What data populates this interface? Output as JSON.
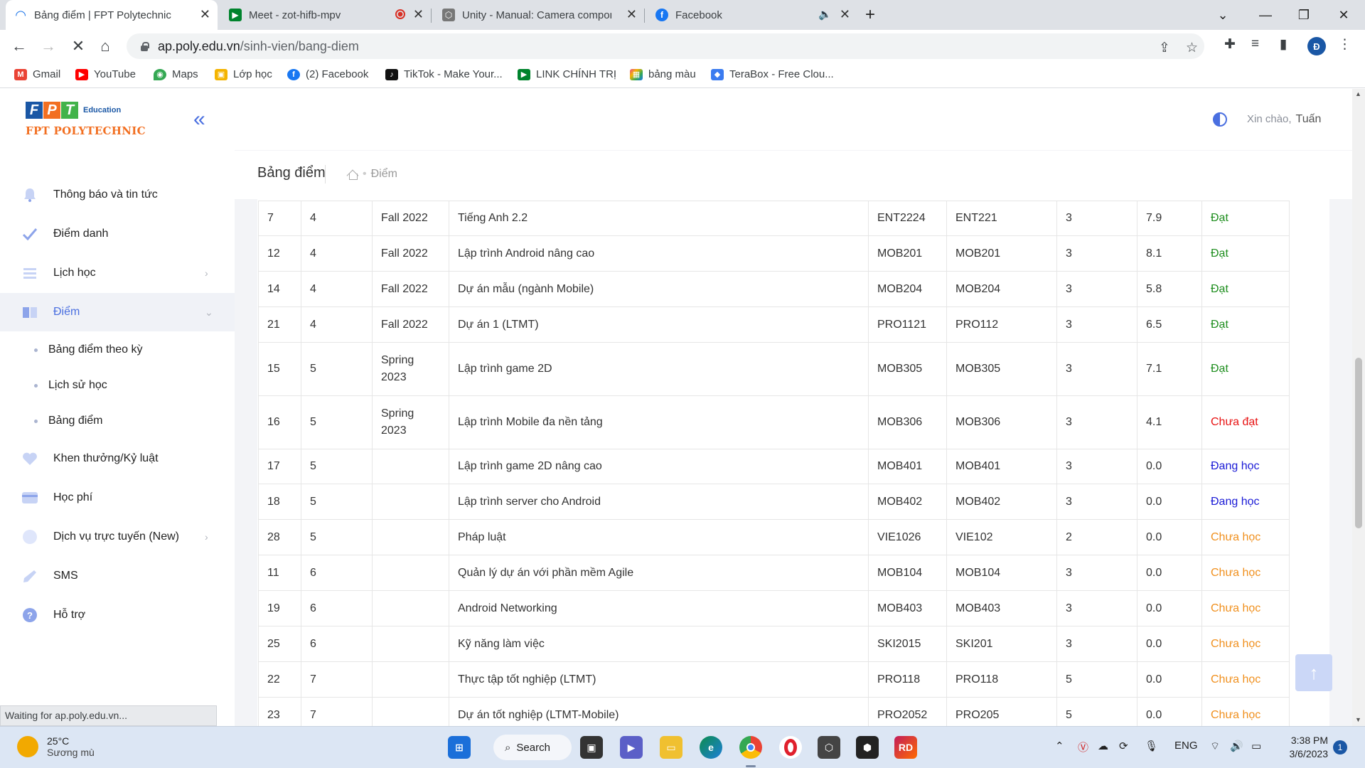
{
  "browser": {
    "tabs": [
      {
        "title": "Bảng điểm | FPT Polytechnic",
        "active": true,
        "fav_color": "#f26f21",
        "fav_glyph": "◠"
      },
      {
        "title": "Meet - zot-hifb-mpv",
        "active": false,
        "fav_color": "#00832d",
        "fav_glyph": "▶"
      },
      {
        "title": "Unity - Manual: Camera compon",
        "active": false,
        "fav_color": "#888888",
        "fav_glyph": "⬡"
      },
      {
        "title": "Facebook",
        "active": false,
        "fav_color": "#1877f2",
        "fav_glyph": "f"
      }
    ],
    "new_tab": "+",
    "url_host": "ap.poly.edu.vn",
    "url_path": "/sinh-vien/bang-diem",
    "profile_initial": "Đ",
    "bookmarks": [
      {
        "label": "Gmail",
        "color": "#ea4335",
        "glyph": "M"
      },
      {
        "label": "YouTube",
        "color": "#ff0000",
        "glyph": "▶"
      },
      {
        "label": "Maps",
        "color": "#34a853",
        "glyph": "◉"
      },
      {
        "label": "Lớp học",
        "color": "#f4b400",
        "glyph": "▣"
      },
      {
        "label": "(2) Facebook",
        "color": "#1877f2",
        "glyph": "f"
      },
      {
        "label": "TikTok - Make Your...",
        "color": "#111111",
        "glyph": "♪"
      },
      {
        "label": "LINK CHÍNH TRỊ",
        "color": "#00832d",
        "glyph": "▶"
      },
      {
        "label": "bảng màu",
        "color": "#e94b8a",
        "glyph": "▦"
      },
      {
        "label": "TeraBox - Free Clou...",
        "color": "#3a7bf0",
        "glyph": "◆"
      }
    ],
    "status_text": "Waiting for ap.poly.edu.vn..."
  },
  "sidebar": {
    "logo_letters": [
      "F",
      "P",
      "T"
    ],
    "logo_colors": [
      "#1a57a5",
      "#f26f21",
      "#42b34a"
    ],
    "logo_edu": "Education",
    "logo_name": "FPT POLYTECHNIC",
    "items": [
      {
        "label": "Thông báo và tin tức",
        "icon": "bell-icon",
        "has_chevron": false
      },
      {
        "label": "Điểm danh",
        "icon": "check-icon",
        "has_chevron": false
      },
      {
        "label": "Lịch học",
        "icon": "list-icon",
        "has_chevron": true
      },
      {
        "label": "Điểm",
        "icon": "book-icon",
        "has_chevron": true,
        "active": true
      },
      {
        "label": "Khen thưởng/Kỷ luật",
        "icon": "heart-icon",
        "has_chevron": false
      },
      {
        "label": "Học phí",
        "icon": "card-icon",
        "has_chevron": false
      },
      {
        "label": "Dịch vụ trực tuyến (New)",
        "icon": "globe-icon",
        "has_chevron": true
      },
      {
        "label": "SMS",
        "icon": "phone-icon",
        "has_chevron": false
      },
      {
        "label": "Hỗ trợ",
        "icon": "help-icon",
        "has_chevron": false
      }
    ],
    "sub_items": [
      "Bảng điểm theo kỳ",
      "Lịch sử học",
      "Bảng điểm"
    ]
  },
  "header": {
    "greeting": "Xin chào,",
    "user_name": "Tuấn"
  },
  "page": {
    "title": "Bảng điểm",
    "breadcrumb": "Điểm"
  },
  "grades": {
    "rows": [
      {
        "no": "7",
        "term": "4",
        "semester": "Fall 2022",
        "subject": "Tiếng Anh 2.2",
        "code": "ENT2224",
        "replace_code": "ENT221",
        "credits": "3",
        "score": "7.9",
        "status": "Đạt"
      },
      {
        "no": "12",
        "term": "4",
        "semester": "Fall 2022",
        "subject": "Lập trình Android nâng cao",
        "code": "MOB201",
        "replace_code": "MOB201",
        "credits": "3",
        "score": "8.1",
        "status": "Đạt"
      },
      {
        "no": "14",
        "term": "4",
        "semester": "Fall 2022",
        "subject": "Dự án mẫu (ngành Mobile)",
        "code": "MOB204",
        "replace_code": "MOB204",
        "credits": "3",
        "score": "5.8",
        "status": "Đạt"
      },
      {
        "no": "21",
        "term": "4",
        "semester": "Fall 2022",
        "subject": "Dự án 1 (LTMT)",
        "code": "PRO1121",
        "replace_code": "PRO112",
        "credits": "3",
        "score": "6.5",
        "status": "Đạt"
      },
      {
        "no": "15",
        "term": "5",
        "semester": "Spring 2023",
        "subject": "Lập trình game 2D",
        "code": "MOB305",
        "replace_code": "MOB305",
        "credits": "3",
        "score": "7.1",
        "status": "Đạt"
      },
      {
        "no": "16",
        "term": "5",
        "semester": "Spring 2023",
        "subject": "Lập trình Mobile đa nền tảng",
        "code": "MOB306",
        "replace_code": "MOB306",
        "credits": "3",
        "score": "4.1",
        "status": "Chưa đạt"
      },
      {
        "no": "17",
        "term": "5",
        "semester": "",
        "subject": "Lập trình game 2D nâng cao",
        "code": "MOB401",
        "replace_code": "MOB401",
        "credits": "3",
        "score": "0.0",
        "status": "Đang học"
      },
      {
        "no": "18",
        "term": "5",
        "semester": "",
        "subject": "Lập trình server cho Android",
        "code": "MOB402",
        "replace_code": "MOB402",
        "credits": "3",
        "score": "0.0",
        "status": "Đang học"
      },
      {
        "no": "28",
        "term": "5",
        "semester": "",
        "subject": "Pháp luật",
        "code": "VIE1026",
        "replace_code": "VIE102",
        "credits": "2",
        "score": "0.0",
        "status": "Chưa học"
      },
      {
        "no": "11",
        "term": "6",
        "semester": "",
        "subject": "Quản lý dự án với phần mềm Agile",
        "code": "MOB104",
        "replace_code": "MOB104",
        "credits": "3",
        "score": "0.0",
        "status": "Chưa học"
      },
      {
        "no": "19",
        "term": "6",
        "semester": "",
        "subject": "Android Networking",
        "code": "MOB403",
        "replace_code": "MOB403",
        "credits": "3",
        "score": "0.0",
        "status": "Chưa học"
      },
      {
        "no": "25",
        "term": "6",
        "semester": "",
        "subject": "Kỹ năng làm việc",
        "code": "SKI2015",
        "replace_code": "SKI201",
        "credits": "3",
        "score": "0.0",
        "status": "Chưa học"
      },
      {
        "no": "22",
        "term": "7",
        "semester": "",
        "subject": "Thực tập tốt nghiệp (LTMT)",
        "code": "PRO118",
        "replace_code": "PRO118",
        "credits": "5",
        "score": "0.0",
        "status": "Chưa học"
      },
      {
        "no": "23",
        "term": "7",
        "semester": "",
        "subject": "Dự án tốt nghiệp (LTMT-Mobile)",
        "code": "PRO2052",
        "replace_code": "PRO205",
        "credits": "5",
        "score": "0.0",
        "status": "Chưa học"
      }
    ],
    "status_colors": {
      "Đạt": "#1e8e1e",
      "Chưa đạt": "#e81212",
      "Đang học": "#1a1ad6",
      "Chưa học": "#f0901e"
    }
  },
  "taskbar": {
    "temperature": "25°C",
    "weather": "Sương mù",
    "search_label": "Search",
    "language": "ENG",
    "time": "3:38 PM",
    "date": "3/6/2023",
    "notification_count": "1"
  }
}
